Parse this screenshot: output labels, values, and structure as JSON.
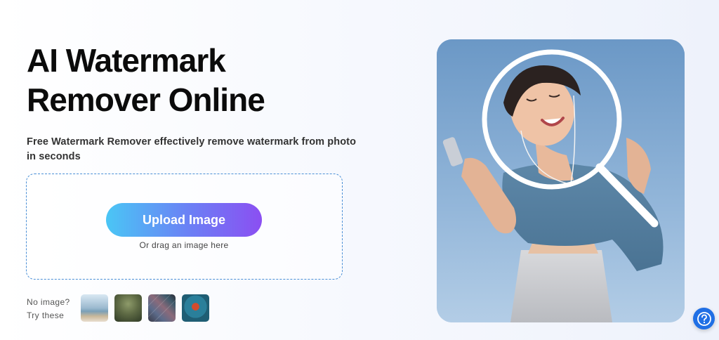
{
  "hero": {
    "title_line1": "AI Watermark",
    "title_line2": "Remover Online",
    "subtitle": "Free Watermark Remover effectively remove watermark from photo in seconds"
  },
  "upload": {
    "button_label": "Upload Image",
    "drag_hint": "Or drag an image here"
  },
  "samples": {
    "prompt_line1": "No image?",
    "prompt_line2": "Try these",
    "items": [
      {
        "name": "sample-beach-icon"
      },
      {
        "name": "sample-landscape-icon"
      },
      {
        "name": "sample-pattern-icon"
      },
      {
        "name": "sample-portrait-icon"
      }
    ]
  },
  "help": {
    "icon": "question-mark-icon"
  },
  "colors": {
    "accent_gradient_start": "#4ac6f5",
    "accent_gradient_end": "#8b4ff2",
    "dashed_border": "#4a8fd6",
    "help_button": "#1f6fe5"
  }
}
